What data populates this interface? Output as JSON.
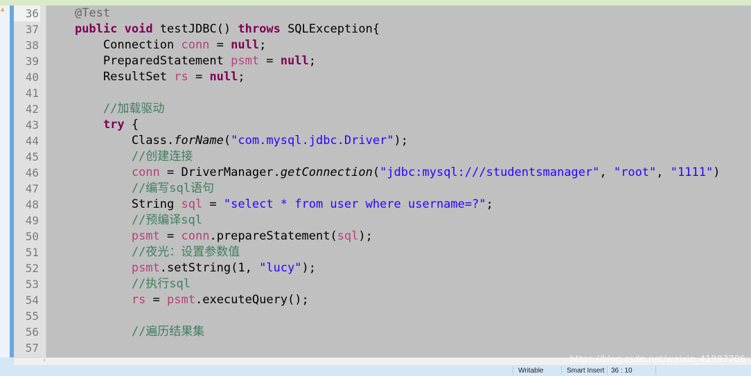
{
  "editor": {
    "lines": [
      {
        "number": "36",
        "tokens": [
          {
            "t": "    "
          },
          {
            "t": "@Test",
            "c": "ann"
          }
        ]
      },
      {
        "number": "37",
        "tokens": [
          {
            "t": "    "
          },
          {
            "t": "public",
            "c": "kw"
          },
          {
            "t": " "
          },
          {
            "t": "void",
            "c": "kw"
          },
          {
            "t": " testJDBC() "
          },
          {
            "t": "throws",
            "c": "kw"
          },
          {
            "t": " SQLException{"
          }
        ]
      },
      {
        "number": "38",
        "tokens": [
          {
            "t": "        Connection "
          },
          {
            "t": "conn",
            "c": "var"
          },
          {
            "t": " = "
          },
          {
            "t": "null",
            "c": "kw"
          },
          {
            "t": ";"
          }
        ]
      },
      {
        "number": "39",
        "tokens": [
          {
            "t": "        PreparedStatement "
          },
          {
            "t": "psmt",
            "c": "var"
          },
          {
            "t": " = "
          },
          {
            "t": "null",
            "c": "kw"
          },
          {
            "t": ";"
          }
        ]
      },
      {
        "number": "40",
        "tokens": [
          {
            "t": "        ResultSet "
          },
          {
            "t": "rs",
            "c": "var"
          },
          {
            "t": " = "
          },
          {
            "t": "null",
            "c": "kw"
          },
          {
            "t": ";"
          }
        ]
      },
      {
        "number": "41",
        "tokens": []
      },
      {
        "number": "42",
        "tokens": [
          {
            "t": "        "
          },
          {
            "t": "//加载驱动",
            "c": "cmt"
          }
        ]
      },
      {
        "number": "43",
        "tokens": [
          {
            "t": "        "
          },
          {
            "t": "try",
            "c": "kw"
          },
          {
            "t": " {"
          }
        ]
      },
      {
        "number": "44",
        "tokens": [
          {
            "t": "            Class."
          },
          {
            "t": "forName",
            "c": "it"
          },
          {
            "t": "("
          },
          {
            "t": "\"com.mysql.jdbc.Driver\"",
            "c": "str"
          },
          {
            "t": ");"
          }
        ]
      },
      {
        "number": "45",
        "tokens": [
          {
            "t": "            "
          },
          {
            "t": "//创建连接",
            "c": "cmt"
          }
        ]
      },
      {
        "number": "46",
        "tokens": [
          {
            "t": "            "
          },
          {
            "t": "conn",
            "c": "var"
          },
          {
            "t": " = DriverManager."
          },
          {
            "t": "getConnection",
            "c": "it"
          },
          {
            "t": "("
          },
          {
            "t": "\"jdbc:mysql:///studentsmanager\"",
            "c": "str"
          },
          {
            "t": ", "
          },
          {
            "t": "\"root\"",
            "c": "str"
          },
          {
            "t": ", "
          },
          {
            "t": "\"1111\"",
            "c": "str"
          },
          {
            "t": ")"
          }
        ]
      },
      {
        "number": "47",
        "tokens": [
          {
            "t": "            "
          },
          {
            "t": "//编写sql语句",
            "c": "cmt"
          }
        ]
      },
      {
        "number": "48",
        "tokens": [
          {
            "t": "            String "
          },
          {
            "t": "sql",
            "c": "var"
          },
          {
            "t": " = "
          },
          {
            "t": "\"select * from user where username=?\"",
            "c": "str"
          },
          {
            "t": ";"
          }
        ]
      },
      {
        "number": "49",
        "tokens": [
          {
            "t": "            "
          },
          {
            "t": "//预编译sql",
            "c": "cmt"
          }
        ]
      },
      {
        "number": "50",
        "tokens": [
          {
            "t": "            "
          },
          {
            "t": "psmt",
            "c": "var"
          },
          {
            "t": " = "
          },
          {
            "t": "conn",
            "c": "var"
          },
          {
            "t": ".prepareStatement("
          },
          {
            "t": "sql",
            "c": "var"
          },
          {
            "t": ");"
          }
        ]
      },
      {
        "number": "51",
        "tokens": [
          {
            "t": "            "
          },
          {
            "t": "//夜光：设置参数值",
            "c": "cmt"
          }
        ]
      },
      {
        "number": "52",
        "tokens": [
          {
            "t": "            "
          },
          {
            "t": "psmt",
            "c": "var"
          },
          {
            "t": ".setString(1, "
          },
          {
            "t": "\"lucy\"",
            "c": "str"
          },
          {
            "t": ");"
          }
        ]
      },
      {
        "number": "53",
        "tokens": [
          {
            "t": "            "
          },
          {
            "t": "//执行sql",
            "c": "cmt"
          }
        ]
      },
      {
        "number": "54",
        "tokens": [
          {
            "t": "            "
          },
          {
            "t": "rs",
            "c": "var"
          },
          {
            "t": " = "
          },
          {
            "t": "psmt",
            "c": "var"
          },
          {
            "t": ".executeQuery();"
          }
        ]
      },
      {
        "number": "55",
        "tokens": []
      },
      {
        "number": "56",
        "tokens": [
          {
            "t": "            "
          },
          {
            "t": "//遍历结果集",
            "c": "cmt"
          }
        ]
      },
      {
        "number": "57",
        "tokens": []
      }
    ]
  },
  "scrollbar": {
    "left_arrow": "‹"
  },
  "watermark": "https://blog.csdn.net/weixin_41987706",
  "status": {
    "mode": "Writable",
    "insert": "Smart Insert",
    "position": "36 : 10"
  },
  "colors": {
    "keyword": "#7f0055",
    "string": "#2a00ff",
    "field": "#b5407a",
    "comment": "#3f7f5f",
    "annotation": "#646464",
    "background": "#c0c0c0"
  },
  "icons": {
    "margin_marker": "warning-icon"
  }
}
